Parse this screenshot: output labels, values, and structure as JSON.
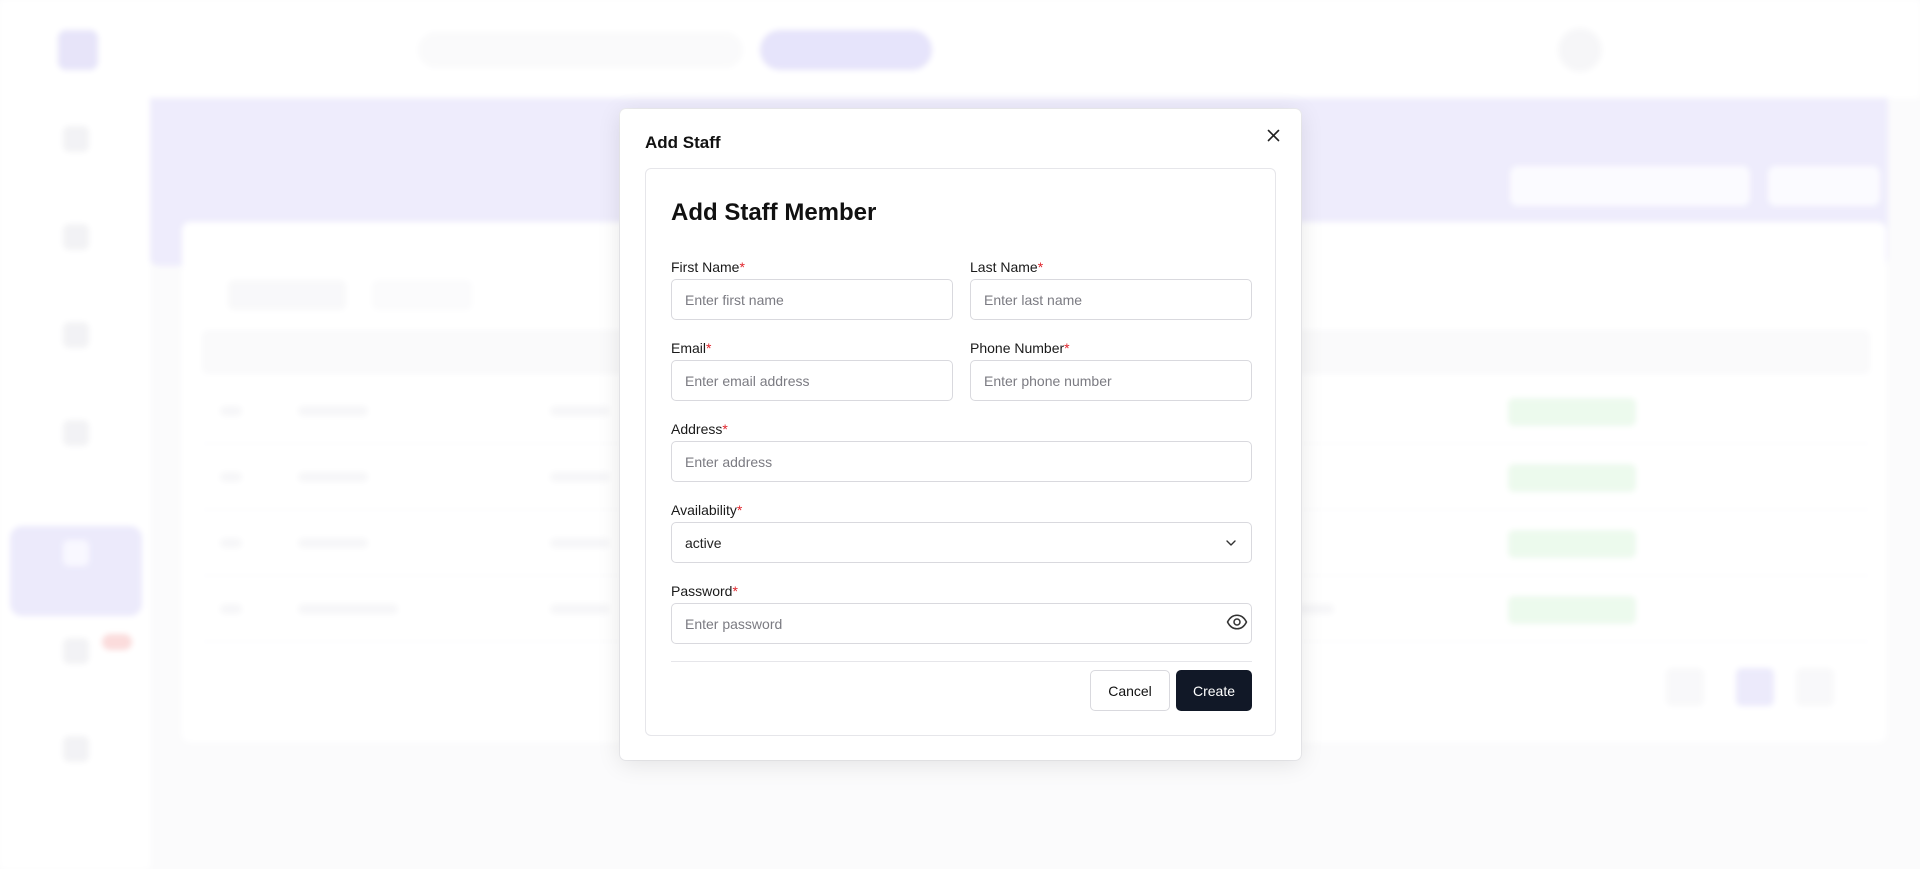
{
  "modal": {
    "title": "Add Staff",
    "heading": "Add Staff Member",
    "required_mark": "*",
    "fields": {
      "first_name": {
        "label": "First Name",
        "placeholder": "Enter first name",
        "value": ""
      },
      "last_name": {
        "label": "Last Name",
        "placeholder": "Enter last name",
        "value": ""
      },
      "email": {
        "label": "Email",
        "placeholder": "Enter email address",
        "value": ""
      },
      "phone": {
        "label": "Phone Number",
        "placeholder": "Enter phone number",
        "value": ""
      },
      "address": {
        "label": "Address",
        "placeholder": "Enter address",
        "value": ""
      },
      "availability": {
        "label": "Availability",
        "selected": "active"
      },
      "password": {
        "label": "Password",
        "placeholder": "Enter password",
        "value": ""
      }
    },
    "buttons": {
      "cancel": "Cancel",
      "create": "Create"
    }
  },
  "icons": {
    "close": "close-icon",
    "chevron": "chevron-down-icon",
    "visibility": "eye-icon"
  },
  "colors": {
    "primary_button": "#111827",
    "required": "#e0242b",
    "accent": "#c8c3f5",
    "status_active": "#d6f3d8"
  }
}
